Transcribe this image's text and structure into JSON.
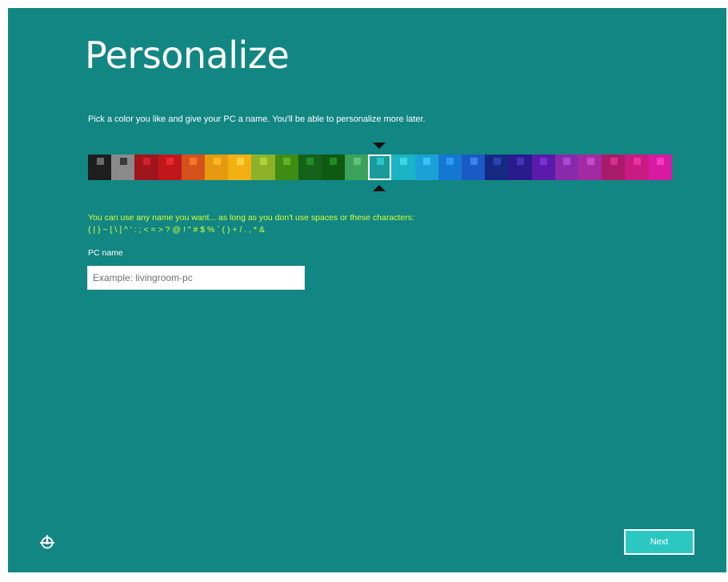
{
  "page": {
    "title": "Personalize",
    "subtitle": "Pick a color you like and give your PC a name. You'll be able to personalize more later.",
    "background_color": "#128683"
  },
  "color_picker": {
    "selected_index": 12,
    "swatches": [
      {
        "bg": "#1e1e1e",
        "dot": "#6a6a6a"
      },
      {
        "bg": "#8a8a8a",
        "dot": "#3a3a3a"
      },
      {
        "bg": "#a0141c",
        "dot": "#d2202c"
      },
      {
        "bg": "#c0171c",
        "dot": "#e82a2e"
      },
      {
        "bg": "#d4521a",
        "dot": "#f2772a"
      },
      {
        "bg": "#e59a12",
        "dot": "#fbba22"
      },
      {
        "bg": "#f2b012",
        "dot": "#fcd23a"
      },
      {
        "bg": "#8cb22a",
        "dot": "#b2d23a"
      },
      {
        "bg": "#3e8c12",
        "dot": "#62b22a"
      },
      {
        "bg": "#14621a",
        "dot": "#248c2a"
      },
      {
        "bg": "#0f5a12",
        "dot": "#228a22"
      },
      {
        "bg": "#3aa25a",
        "dot": "#62c27a"
      },
      {
        "bg": "#1a9a9a",
        "dot": "#2ac6c6"
      },
      {
        "bg": "#1ab4c4",
        "dot": "#3ad8e4"
      },
      {
        "bg": "#1aa2d8",
        "dot": "#3ac4f4"
      },
      {
        "bg": "#1478d2",
        "dot": "#2a9cf4"
      },
      {
        "bg": "#1a5ac4",
        "dot": "#3a82ec"
      },
      {
        "bg": "#142a82",
        "dot": "#2a44b2"
      },
      {
        "bg": "#2a1a8c",
        "dot": "#4a32b8"
      },
      {
        "bg": "#5a1aaa",
        "dot": "#7a32d2"
      },
      {
        "bg": "#8a2aaa",
        "dot": "#aa4ad2"
      },
      {
        "bg": "#a22aa2",
        "dot": "#c84ac8"
      },
      {
        "bg": "#aa1a6a",
        "dot": "#d4328c"
      },
      {
        "bg": "#c81a82",
        "dot": "#ec32a2"
      },
      {
        "bg": "#d81aa2",
        "dot": "#f43ac2"
      }
    ]
  },
  "name_rules": {
    "line1": "You can use any name you want... as long as you don't use spaces or these characters:",
    "line2": "{ | } ~ [ \\ ] ^ ' : ; < = > ? @ ! \" # $ % ` ( ) + / . , * &"
  },
  "pc_name": {
    "label": "PC name",
    "value": "",
    "placeholder": "Example: livingroom-pc"
  },
  "footer": {
    "next_label": "Next",
    "ease_of_access_icon": "ease-of-access-icon",
    "button_color": "#2bc8c2"
  }
}
